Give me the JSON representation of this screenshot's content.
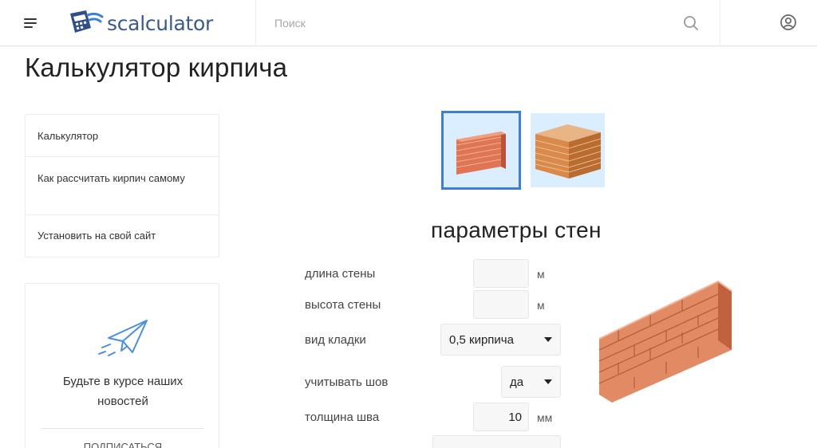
{
  "header": {
    "logo_text": "scalculator",
    "search_placeholder": "Поиск",
    "search_value": "",
    "icons": {
      "menu": "hamburger-menu-icon",
      "logo": "calculator-logo-icon",
      "search": "search-icon",
      "user": "user-account-icon"
    }
  },
  "page": {
    "title": "Калькулятор кирпича"
  },
  "sidebar": {
    "items": [
      {
        "label": "Калькулятор"
      },
      {
        "label": "Как рассчитать кирпич самому"
      },
      {
        "label": "Установить на свой сайт"
      }
    ]
  },
  "newsletter": {
    "icon": "paper-plane-icon",
    "text": "Будьте в курсе наших новостей",
    "more_label": "ПОДПИСАТЬСЯ"
  },
  "wall_types": [
    {
      "name": "wall",
      "selected": true
    },
    {
      "name": "building",
      "selected": false
    }
  ],
  "form": {
    "section_title": "параметры стен",
    "wall_length": {
      "label": "длина стены",
      "value": "",
      "unit": "м"
    },
    "wall_height": {
      "label": "высота стены",
      "value": "",
      "unit": "м"
    },
    "masonry_type": {
      "label": "вид кладки",
      "value": "0,5 кирпича"
    },
    "consider_joint": {
      "label": "учитывать шов",
      "value": "да"
    },
    "joint_thickness": {
      "label": "толщина шва",
      "value": "10",
      "unit": "мм"
    }
  },
  "colors": {
    "accent": "#3d7fd6",
    "brand": "#3a5a8c",
    "brick": "#d9714f",
    "tile_bg": "#dbeeff"
  }
}
